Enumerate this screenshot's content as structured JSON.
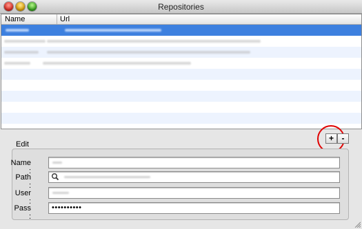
{
  "window": {
    "title": "Repositories"
  },
  "table": {
    "columns": [
      "Name",
      "Url"
    ],
    "rows": [
      {
        "name": "",
        "url": "",
        "selected": true
      },
      {
        "name": "",
        "url": ""
      },
      {
        "name": "",
        "url": ""
      },
      {
        "name": "",
        "url": ""
      },
      {
        "name": "",
        "url": ""
      },
      {
        "name": "",
        "url": ""
      },
      {
        "name": "",
        "url": ""
      },
      {
        "name": "",
        "url": ""
      },
      {
        "name": "",
        "url": ""
      },
      {
        "name": "",
        "url": ""
      }
    ]
  },
  "toolbar": {
    "add_label": "+",
    "remove_label": "-"
  },
  "edit": {
    "group_label": "Edit",
    "name_label": "Name :",
    "path_label": "Path :",
    "user_label": "User :",
    "pass_label": "Pass :",
    "name_value": "",
    "path_value": "",
    "user_value": "",
    "pass_value": "••••••••••"
  },
  "icons": {
    "search": "magnifier-icon"
  },
  "colors": {
    "selection": "#3d80df",
    "annotation": "#e00000"
  }
}
